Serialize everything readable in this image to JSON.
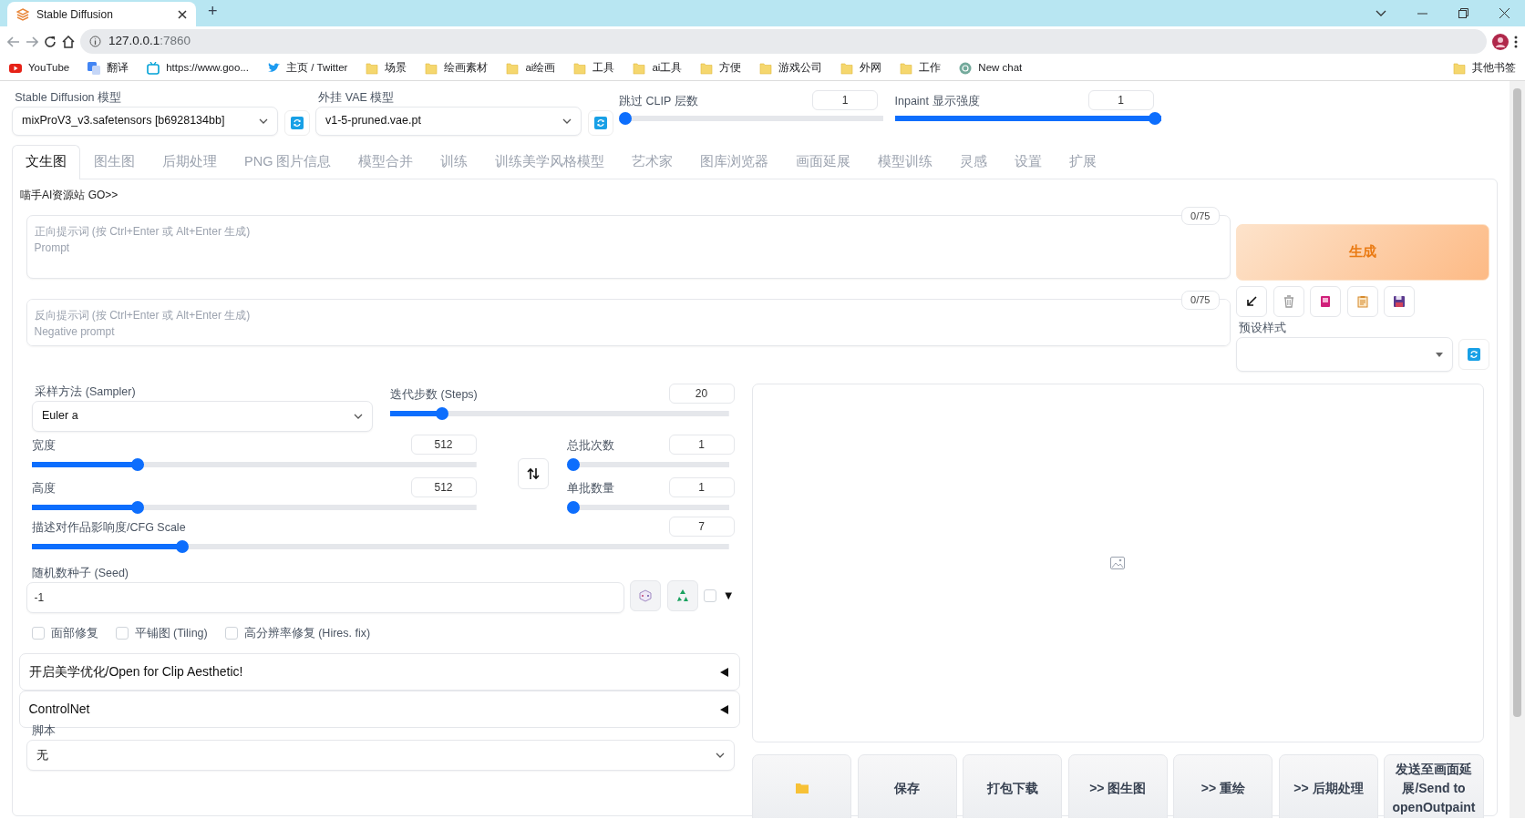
{
  "browser": {
    "tab_title": "Stable Diffusion",
    "new_tab": "+",
    "address_host": "127.0.0.1",
    "address_port": ":7860",
    "bookmarks": [
      {
        "label": "YouTube",
        "kind": "video"
      },
      {
        "label": "翻译",
        "kind": "translate"
      },
      {
        "label": "https://www.goo...",
        "kind": "tv"
      },
      {
        "label": "主页 / Twitter",
        "kind": "bird"
      },
      {
        "label": "场景",
        "kind": "folder"
      },
      {
        "label": "绘画素材",
        "kind": "folder"
      },
      {
        "label": "ai绘画",
        "kind": "folder"
      },
      {
        "label": "工具",
        "kind": "folder"
      },
      {
        "label": "ai工具",
        "kind": "folder"
      },
      {
        "label": "方便",
        "kind": "folder"
      },
      {
        "label": "游戏公司",
        "kind": "folder"
      },
      {
        "label": "外网",
        "kind": "folder"
      },
      {
        "label": "工作",
        "kind": "folder"
      },
      {
        "label": "New chat",
        "kind": "chat"
      }
    ],
    "other_bookmarks": "其他书签"
  },
  "top_settings": {
    "model": {
      "label": "Stable Diffusion 模型",
      "value": "mixProV3_v3.safetensors [b6928134bb]"
    },
    "vae": {
      "label": "外挂 VAE 模型",
      "value": "v1-5-pruned.vae.pt"
    },
    "clip_skip": {
      "label": "跳过 CLIP 层数",
      "value": "1",
      "level": 0
    },
    "inpaint": {
      "label": "Inpaint 显示强度",
      "value": "1",
      "level": 1
    }
  },
  "tabs": [
    {
      "label": "文生图",
      "selected": true
    },
    {
      "label": "图生图",
      "selected": false
    },
    {
      "label": "后期处理",
      "selected": false
    },
    {
      "label": "PNG 图片信息",
      "selected": false
    },
    {
      "label": "模型合并",
      "selected": false
    },
    {
      "label": "训练",
      "selected": false
    },
    {
      "label": "训练美学风格模型",
      "selected": false
    },
    {
      "label": "艺术家",
      "selected": false
    },
    {
      "label": "图库浏览器",
      "selected": false
    },
    {
      "label": "画面延展",
      "selected": false
    },
    {
      "label": "模型训练",
      "selected": false
    },
    {
      "label": "灵感",
      "selected": false
    },
    {
      "label": "设置",
      "selected": false
    },
    {
      "label": "扩展",
      "selected": false
    }
  ],
  "promo_link": "喵手AI资源站 GO>>",
  "prompt": {
    "placeholder": "正向提示词 (按 Ctrl+Enter 或 Alt+Enter 生成)\nPrompt",
    "counter": "0/75"
  },
  "negative_prompt": {
    "placeholder": "反向提示词 (按 Ctrl+Enter 或 Alt+Enter 生成)\nNegative prompt",
    "counter": "0/75"
  },
  "generate_button": "生成",
  "styles": {
    "label": "预设样式"
  },
  "sampler": {
    "label": "采样方法 (Sampler)",
    "value": "Euler a"
  },
  "steps": {
    "label": "迭代步数 (Steps)",
    "value": "20",
    "level": 0.14
  },
  "width": {
    "label": "宽度",
    "value": "512",
    "level": 0.23
  },
  "height": {
    "label": "高度",
    "value": "512",
    "level": 0.23
  },
  "batch_count": {
    "label": "总批次数",
    "value": "1",
    "level": 0
  },
  "batch_size": {
    "label": "单批数量",
    "value": "1",
    "level": 0
  },
  "cfg_scale": {
    "label": "描述对作品影响度/CFG Scale",
    "value": "7",
    "level": 0.21
  },
  "seed": {
    "label": "随机数种子 (Seed)",
    "value": "-1",
    "extra_checked": false,
    "extra_toggle": "▼"
  },
  "options": [
    {
      "label": "面部修复",
      "checked": false
    },
    {
      "label": "平铺图 (Tiling)",
      "checked": false
    },
    {
      "label": "高分辨率修复 (Hires. fix)",
      "checked": false
    }
  ],
  "accordions": [
    {
      "title": "开启美学优化/Open for Clip Aesthetic!",
      "expanded": false
    },
    {
      "title": "ControlNet",
      "expanded": false
    }
  ],
  "script": {
    "label": "脚本",
    "value": "无"
  },
  "output_buttons": [
    {
      "kind": "folder"
    },
    {
      "kind": "text",
      "label": "保存"
    },
    {
      "kind": "text",
      "label": "打包下载"
    },
    {
      "kind": "text",
      "label": ">> 图生图"
    },
    {
      "kind": "text",
      "label": ">> 重绘"
    },
    {
      "kind": "text",
      "label": ">> 后期处理"
    },
    {
      "kind": "text",
      "label": "发送至画面延展/Send to openOutpaint"
    }
  ]
}
